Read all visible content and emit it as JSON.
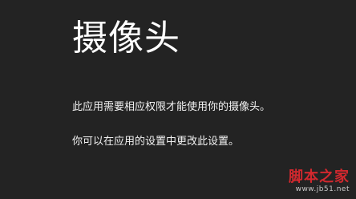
{
  "app": {
    "title": "摄像头"
  },
  "message": {
    "line1": "此应用需要相应权限才能使用你的摄像头。",
    "line2": "你可以在应用的设置中更改此设置。"
  },
  "watermark": {
    "text": "脚本之家",
    "url": "www.jb51.net"
  },
  "colors": {
    "background": "#232323",
    "text": "#ffffff",
    "watermark": "#d2282e"
  }
}
